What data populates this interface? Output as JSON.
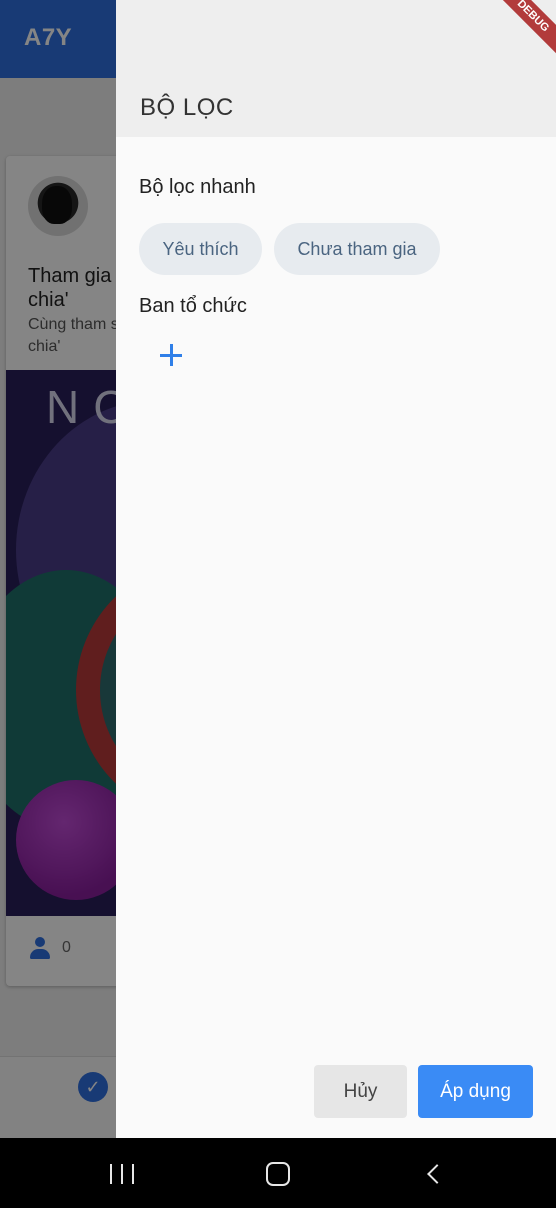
{
  "background": {
    "app_title": "A7Y",
    "post_title": "Tham gia chia'",
    "post_subtitle": "Cùng tham sẻ chia'",
    "image_text": "NC",
    "participant_count": "0"
  },
  "drawer": {
    "title": "BỘ LỌC",
    "quick_filter_label": "Bộ lọc nhanh",
    "chips": [
      "Yêu thích",
      "Chưa tham gia"
    ],
    "organizer_label": "Ban tổ chức",
    "cancel_label": "Hủy",
    "apply_label": "Áp dụng"
  },
  "debug_banner": "DEBUG",
  "colors": {
    "primary": "#2f6fe0",
    "apply_button": "#3a8bf5",
    "chip_bg": "#e7ebef"
  },
  "icons": {
    "add": "plus-icon",
    "person": "person-icon",
    "verified": "verified-badge-icon",
    "nav": [
      "recents-icon",
      "home-icon",
      "back-icon"
    ]
  }
}
